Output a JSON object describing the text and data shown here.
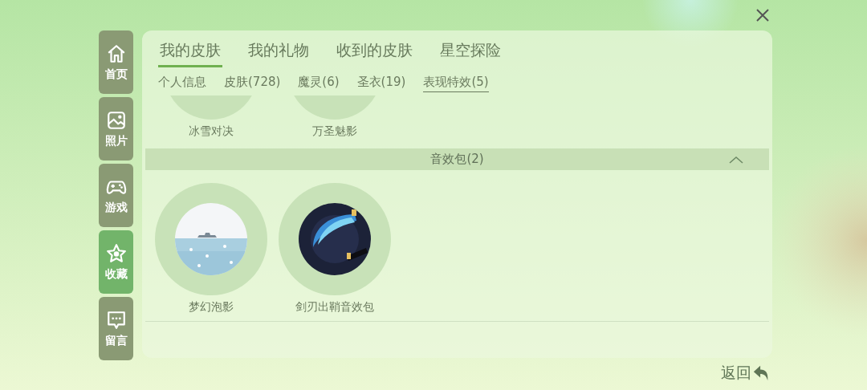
{
  "sidebar": {
    "items": [
      {
        "label": "首页",
        "selected": false
      },
      {
        "label": "照片",
        "selected": false
      },
      {
        "label": "游戏",
        "selected": false
      },
      {
        "label": "收藏",
        "selected": true
      },
      {
        "label": "留言",
        "selected": false
      }
    ]
  },
  "tabs": [
    {
      "label": "我的皮肤",
      "selected": true
    },
    {
      "label": "我的礼物",
      "selected": false
    },
    {
      "label": "收到的皮肤",
      "selected": false
    },
    {
      "label": "星空探险",
      "selected": false
    }
  ],
  "subtabs": [
    {
      "label": "个人信息",
      "selected": false
    },
    {
      "label": "皮肤(728)",
      "selected": false
    },
    {
      "label": "魔灵(6)",
      "selected": false
    },
    {
      "label": "圣衣(19)",
      "selected": false
    },
    {
      "label": "表现特效(5)",
      "selected": true
    }
  ],
  "scrolled_items": [
    {
      "name": "冰雪对决"
    },
    {
      "name": "万圣魅影"
    }
  ],
  "section": {
    "title": "音效包(2)",
    "expanded": true,
    "items": [
      {
        "name": "梦幻泡影",
        "kind": "picture"
      },
      {
        "name": "剑刃出鞘音效包",
        "kind": "picture"
      }
    ]
  },
  "back": {
    "label": "返回"
  }
}
